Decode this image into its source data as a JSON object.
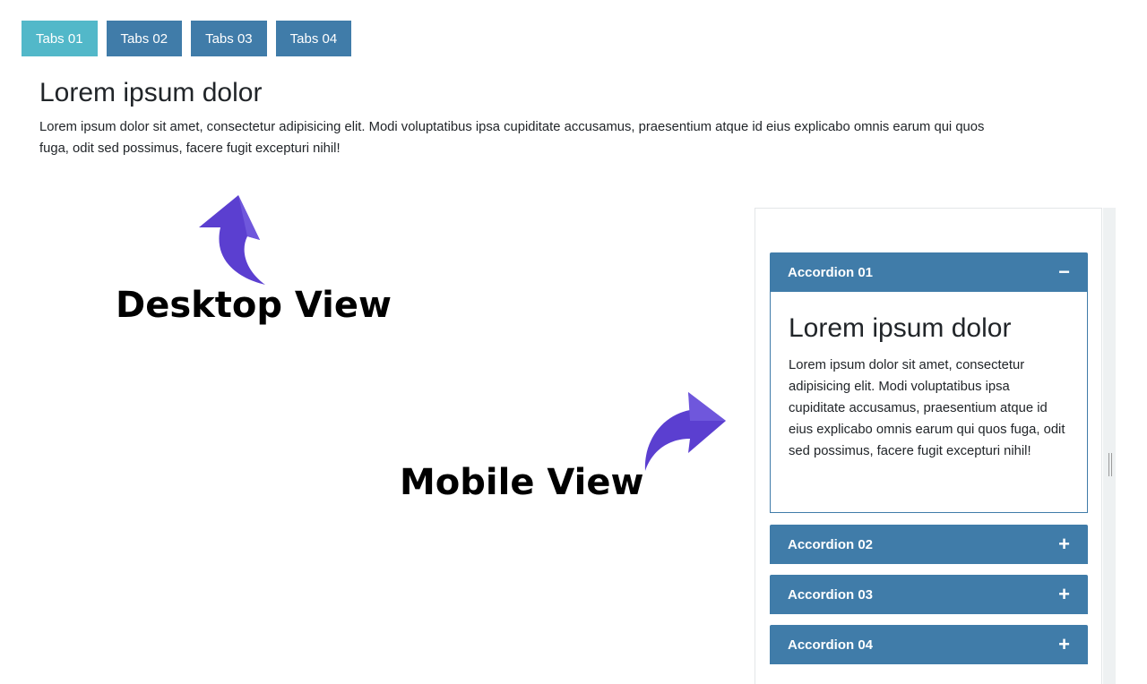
{
  "tabs": [
    {
      "label": "Tabs 01",
      "active": true
    },
    {
      "label": "Tabs 02",
      "active": false
    },
    {
      "label": "Tabs 03",
      "active": false
    },
    {
      "label": "Tabs 04",
      "active": false
    }
  ],
  "desktop": {
    "title": "Lorem ipsum dolor",
    "text": "Lorem ipsum dolor sit amet, consectetur adipisicing elit. Modi voluptatibus ipsa cupiditate accusamus, praesentium atque id eius explicabo omnis earum qui quos fuga, odit sed possimus, facere fugit excepturi nihil!"
  },
  "annotations": {
    "desktop_label": "Desktop View",
    "mobile_label": "Mobile View",
    "arrow_color": "#5b3fd0"
  },
  "accordion": [
    {
      "label": "Accordion 01",
      "icon": "−",
      "icon_name": "minus-icon",
      "open": true
    },
    {
      "label": "Accordion 02",
      "icon": "+",
      "icon_name": "plus-icon",
      "open": false
    },
    {
      "label": "Accordion 03",
      "icon": "+",
      "icon_name": "plus-icon",
      "open": false
    },
    {
      "label": "Accordion 04",
      "icon": "+",
      "icon_name": "plus-icon",
      "open": false
    }
  ],
  "accordion_content": {
    "title": "Lorem ipsum dolor",
    "text": "Lorem ipsum dolor sit amet, consectetur adipisicing elit. Modi voluptatibus ipsa cupiditate accusamus, praesentium atque id eius explicabo omnis earum qui quos fuga, odit sed possimus, facere fugit excepturi nihil!"
  },
  "colors": {
    "tab_active": "#52b8c9",
    "tab_inactive": "#407ca9",
    "accordion_header": "#407ca9"
  }
}
